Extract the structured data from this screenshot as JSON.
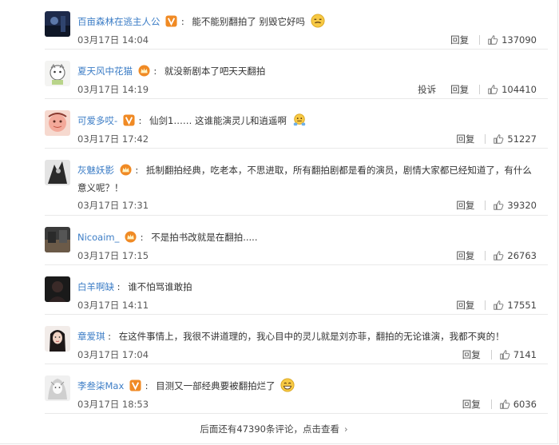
{
  "comments": [
    {
      "user": "百亩森林在逃主人公",
      "badge": "vip-v",
      "text": "能不能别翻拍了 别毁它好吗",
      "emoji": "awkward-emoji",
      "date": "03月17日 14:04",
      "report": "",
      "reply": "回复",
      "likes": "137090"
    },
    {
      "user": "夏天风中花猫",
      "badge": "crown",
      "text": "就没新剧本了吧天天翻拍",
      "emoji": "",
      "date": "03月17日 14:19",
      "report": "投诉",
      "reply": "回复",
      "likes": "104410"
    },
    {
      "user": "可爱多哎-",
      "badge": "vip-v",
      "text": "仙剑1…… 这谁能演灵儿和逍遥啊",
      "emoji": "shrug-emoji",
      "date": "03月17日 17:42",
      "report": "",
      "reply": "回复",
      "likes": "51227"
    },
    {
      "user": "灰魅妖影",
      "badge": "crown",
      "text": "抵制翻拍经典，吃老本，不思进取，所有翻拍剧都是看的演员，剧情大家都已经知道了，有什么意义呢？！",
      "emoji": "",
      "date": "03月17日 17:31",
      "report": "",
      "reply": "回复",
      "likes": "39320"
    },
    {
      "user": "Nicoaim_",
      "badge": "crown",
      "text": "不是拍书改就是在翻拍.....",
      "emoji": "",
      "date": "03月17日 17:15",
      "report": "",
      "reply": "回复",
      "likes": "26763"
    },
    {
      "user": "白羊啊缺",
      "badge": "",
      "text": "谁不怕骂谁敢拍",
      "emoji": "",
      "date": "03月17日 14:11",
      "report": "",
      "reply": "回复",
      "likes": "17551"
    },
    {
      "user": "章爱琪",
      "badge": "",
      "text": "在这件事情上，我很不讲道理的，我心目中的灵儿就是刘亦菲，翻拍的无论谁演，我都不爽的！",
      "emoji": "",
      "date": "03月17日 17:04",
      "report": "",
      "reply": "回复",
      "likes": "7141"
    },
    {
      "user": "李叁柒Max",
      "badge": "vip-v",
      "text": "目测又一部经典要被翻拍烂了",
      "emoji": "grin-emoji",
      "date": "03月17日 18:53",
      "report": "",
      "reply": "回复",
      "likes": "6036"
    }
  ],
  "footer": {
    "more_text": "后面还有47390条评论，点击查看",
    "chevron": "›"
  },
  "colors": {
    "username": "#3c7dc6",
    "badge_orange": "#f08a24",
    "separator": "#e9e9e9"
  }
}
